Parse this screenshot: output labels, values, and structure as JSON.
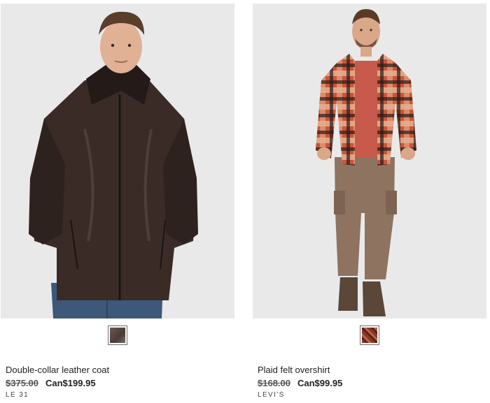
{
  "products": [
    {
      "name": "Double-collar leather coat",
      "old_price": "$375.00",
      "sale_price": "Can$199.95",
      "brand": "LE 31",
      "swatch_color": "#5a4a44",
      "icons": [
        "product-image",
        "color-swatch"
      ]
    },
    {
      "name": "Plaid felt overshirt",
      "old_price": "$168.00",
      "sale_price": "Can$99.95",
      "brand": "LEVI'S",
      "swatch_color": "#8a3a26",
      "icons": [
        "product-image",
        "color-swatch"
      ]
    }
  ],
  "colors": {
    "background": "#ffffff",
    "photo_background": "#e9e9e9",
    "text": "#222222",
    "strike_price": "#555555"
  }
}
